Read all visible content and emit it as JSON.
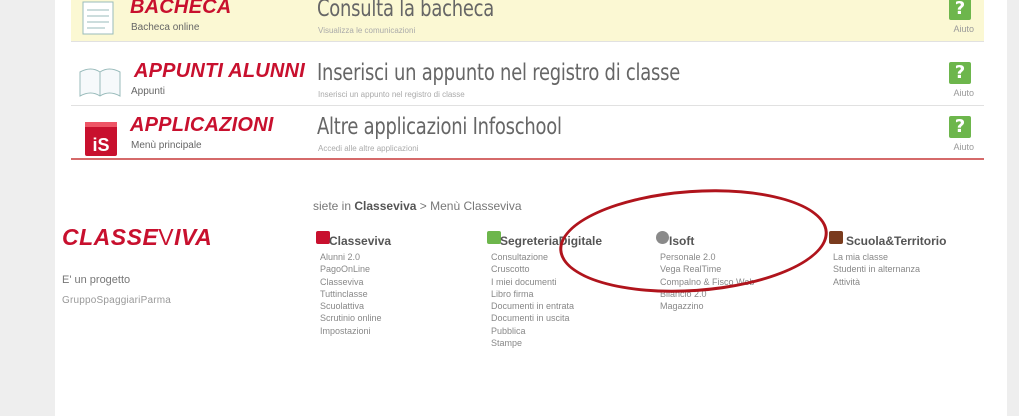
{
  "menu_rows": [
    {
      "title": "BACHECA",
      "subtitle": "Bacheca online",
      "heading": "Consulta la bacheca",
      "description": "Visualizza le comunicazioni",
      "help_label": "Aiuto",
      "icon": "notebook-icon"
    },
    {
      "title": "APPUNTI ALUNNI",
      "subtitle": "Appunti",
      "heading": "Inserisci un appunto nel registro di classe",
      "description": "Inserisci un appunto nel registro di classe",
      "help_label": "Aiuto",
      "icon": "open-book-icon"
    },
    {
      "title": "APPLICAZIONI",
      "subtitle": "Menù principale",
      "heading": "Altre applicazioni Infoschool",
      "description": "Accedi alle altre applicazioni",
      "help_label": "Aiuto",
      "icon": "infoschool-is-icon"
    }
  ],
  "help_glyph": "?",
  "breadcrumb": {
    "prefix": "siete in",
    "current": "Classeviva",
    "separator": ">",
    "page": "Menù Classeviva"
  },
  "footer": {
    "logo_a": "CLASSE",
    "logo_v": "V",
    "logo_b": "IVA",
    "project_text": "E' un progetto",
    "company": "GruppoSpaggiariParma"
  },
  "columns": [
    {
      "title": "Classeviva",
      "color": "#c8102e",
      "items": [
        "Alunni 2.0",
        "PagoOnLine",
        "Classeviva",
        "Tuttinclasse",
        "Scuolattiva",
        "Scrutinio online",
        "Impostazioni"
      ]
    },
    {
      "title": "SegreteriaDigitale",
      "color": "#6db64c",
      "items": [
        "Consultazione",
        "Cruscotto",
        "I miei documenti",
        "Libro firma",
        "Documenti in entrata",
        "Documenti in uscita",
        "Pubblica",
        "Stampe"
      ]
    },
    {
      "title": "Isoft",
      "color": "#8a8a8a",
      "items": [
        "Personale 2.0",
        "Vega RealTime",
        "Compalno & Fisco Web",
        "Bilancio 2.0",
        "Magazzino"
      ]
    },
    {
      "title": "Scuola&Territorio",
      "color": "#7a3b1e",
      "items": [
        "La mia classe",
        "Studenti in alternanza",
        "Attività"
      ]
    }
  ],
  "colors": {
    "brand_red": "#c8102e",
    "help_green": "#6db64c",
    "highlight_yellow": "#fbf8d3",
    "annotation_circle": "#b0141c"
  }
}
